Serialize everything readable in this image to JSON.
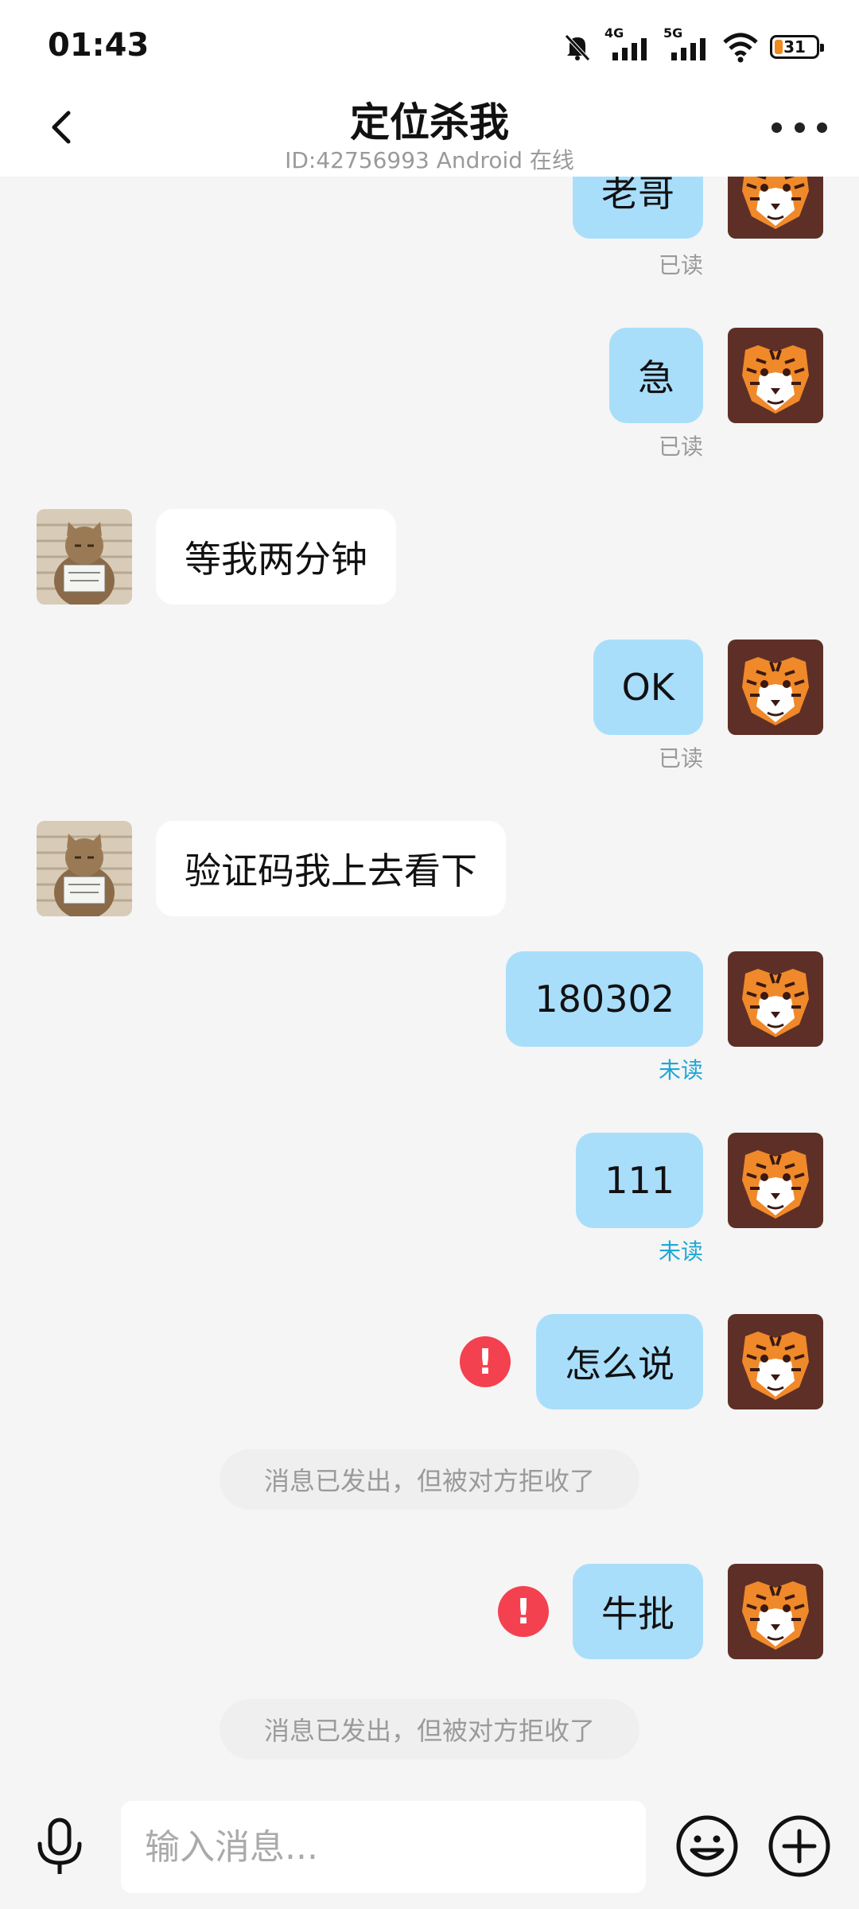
{
  "status_bar": {
    "time": "01:43",
    "network_1": "4G",
    "network_2": "5G",
    "battery": "31"
  },
  "header": {
    "title": "定位杀我",
    "subtitle": "ID:42756993 Android 在线"
  },
  "messages": [
    {
      "sender": "me",
      "text": "老哥",
      "status": "已读"
    },
    {
      "sender": "me",
      "text": "急",
      "status": "已读"
    },
    {
      "sender": "them",
      "text": "等我两分钟"
    },
    {
      "sender": "me",
      "text": "OK",
      "status": "已读"
    },
    {
      "sender": "them",
      "text": "验证码我上去看下"
    },
    {
      "sender": "me",
      "text": "180302",
      "status": "未读"
    },
    {
      "sender": "me",
      "text": "111",
      "status": "未读"
    },
    {
      "sender": "me",
      "text": "怎么说",
      "error": true
    },
    {
      "system": "消息已发出，但被对方拒收了"
    },
    {
      "sender": "me",
      "text": "牛批",
      "error": true
    },
    {
      "system": "消息已发出，但被对方拒收了"
    }
  ],
  "input": {
    "placeholder": "输入消息..."
  },
  "colors": {
    "my_bubble": "#a9defb",
    "their_bubble": "#ffffff",
    "unread": "#1ea7d6",
    "error": "#f4414f",
    "tiger_bg": "#5e2f26"
  },
  "icons": [
    "back-arrow-icon",
    "more-icon",
    "mic-icon",
    "emoji-icon",
    "plus-icon",
    "error-icon",
    "bell-muted-icon",
    "wifi-icon"
  ]
}
